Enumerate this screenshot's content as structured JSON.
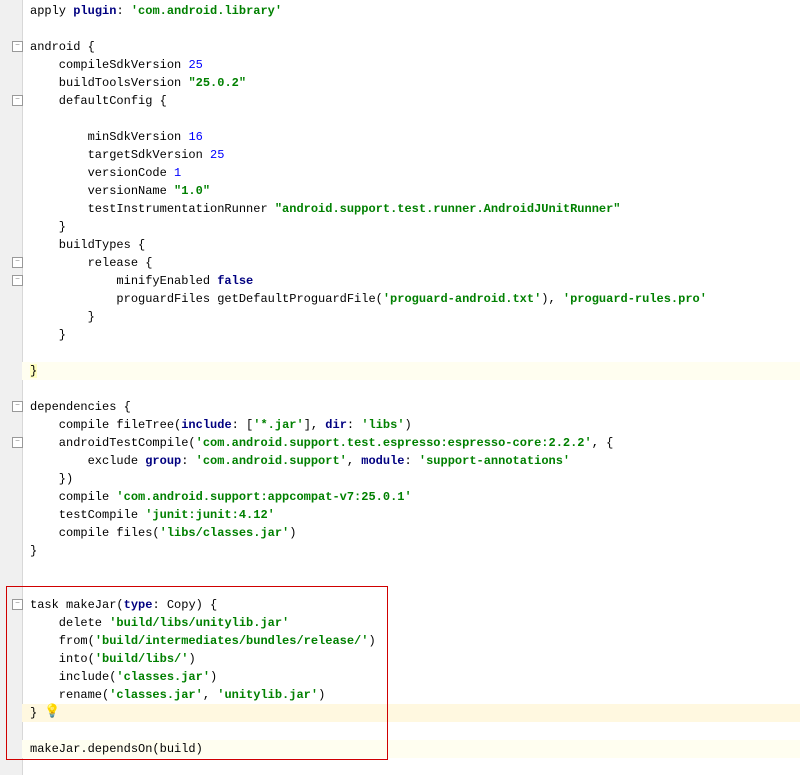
{
  "code": {
    "apply": "apply",
    "plugin": "plugin",
    "pluginVal": "'com.android.library'",
    "android": "android {",
    "compileSdk": "    compileSdkVersion ",
    "compileSdkVal": "25",
    "buildTools": "    buildToolsVersion ",
    "buildToolsVal": "\"25.0.2\"",
    "defaultConfig": "    defaultConfig {",
    "minSdk": "        minSdkVersion ",
    "minSdkVal": "16",
    "targetSdk": "        targetSdkVersion ",
    "targetSdkVal": "25",
    "versionCode": "        versionCode ",
    "versionCodeVal": "1",
    "versionName": "        versionName ",
    "versionNameVal": "\"1.0\"",
    "testRunner": "        testInstrumentationRunner ",
    "testRunnerVal": "\"android.support.test.runner.AndroidJUnitRunner\"",
    "closeDefaultConfig": "    }",
    "buildTypes": "    buildTypes {",
    "release": "        release {",
    "minify": "            minifyEnabled ",
    "minifyVal": "false",
    "proguard1": "            proguardFiles getDefaultProguardFile(",
    "proguardAndroid": "'proguard-android.txt'",
    "proguard2": "), ",
    "proguardRules": "'proguard-rules.pro'",
    "closeRelease": "        }",
    "closeBuildTypes": "    }",
    "closeAndroid": "}",
    "dependencies": "dependencies {",
    "compileFileTree1": "    compile fileTree(",
    "include": "include",
    "includeVal": "'*.jar'",
    "dir": "dir",
    "dirVal": "'libs'",
    "androidTestCompile1": "    androidTestCompile(",
    "espresso": "'com.android.support.test.espresso:espresso-core:2.2.2'",
    "exclude1": "        exclude ",
    "group": "group",
    "groupVal": "'com.android.support'",
    "module": "module",
    "moduleVal": "'support-annotations'",
    "closeAtc": "    })",
    "compileAppcompat": "    compile ",
    "appcompat": "'com.android.support:appcompat-v7:25.0.1'",
    "testCompile": "    testCompile ",
    "junit": "'junit:junit:4.12'",
    "compileFiles1": "    compile files(",
    "classesJar": "'libs/classes.jar'",
    "closeDeps": "}",
    "taskMakeJar1": "task makeJar(",
    "type": "type",
    "typeCopy": ": Copy) {",
    "delete": "    delete ",
    "unitylib": "'build/libs/unitylib.jar'",
    "from": "    from(",
    "fromPath": "'build/intermediates/bundles/release/'",
    "into": "    into(",
    "intoPath": "'build/libs/'",
    "includeCall": "    include(",
    "includeJar": "'classes.jar'",
    "rename": "    rename(",
    "renameFrom": "'classes.jar'",
    "renameTo": "'unitylib.jar'",
    "closeTask": "}",
    "dependsOn": "makeJar.dependsOn(build)"
  }
}
